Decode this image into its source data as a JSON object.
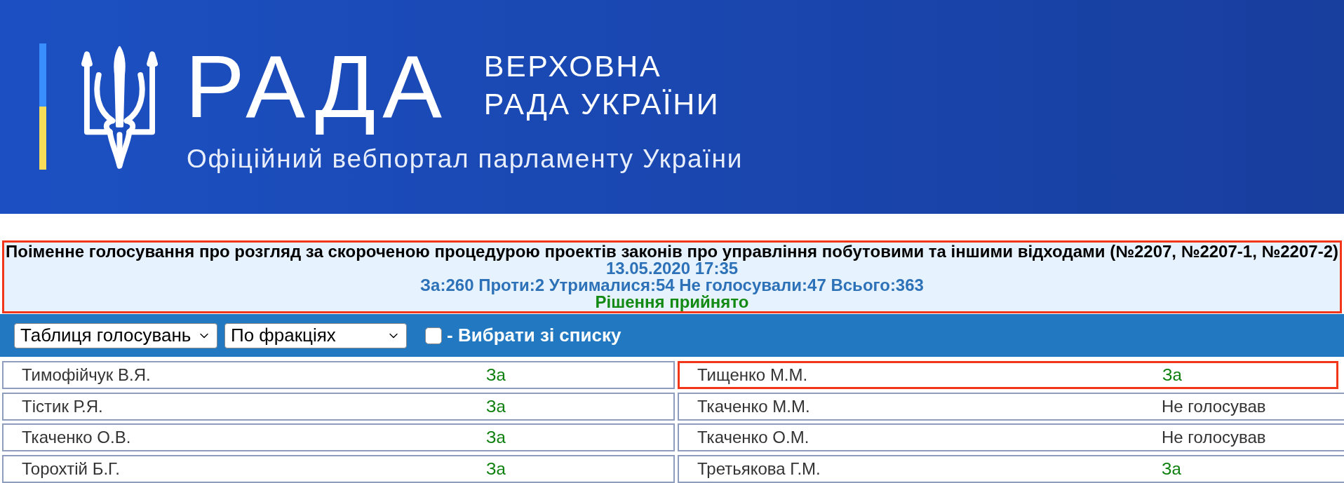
{
  "header": {
    "logo_text": "РАДА",
    "title_lines": [
      "ВЕРХОВНА",
      "РАДА УКРАЇНИ"
    ],
    "tagline": "Офіційний вебпортал парламенту України"
  },
  "vote_summary": {
    "highlighted": true,
    "title": "Поіменне голосування про розгляд за скороченою процедурою проектів законів про управління побутовими та іншими відходами (№2207, №2207-1, №2207-2)",
    "datetime": "13.05.2020 17:35",
    "counts": "За:260 Проти:2 Утрималися:54 Не голосували:47 Всього:363",
    "decision": "Рішення прийнято"
  },
  "toolbar": {
    "dropdowns": [
      {
        "value": "Таблиця голосувань"
      },
      {
        "value": "По фракціях"
      }
    ],
    "checkbox": {
      "checked": false,
      "label": "- Вибрати зі списку"
    }
  },
  "columns": [
    {
      "rows": [
        {
          "name": "Тимофійчук В.Я.",
          "vote": "За",
          "kind": "for",
          "highlighted": false
        },
        {
          "name": "Тістик Р.Я.",
          "vote": "За",
          "kind": "for",
          "highlighted": false
        },
        {
          "name": "Ткаченко О.В.",
          "vote": "За",
          "kind": "for",
          "highlighted": false
        },
        {
          "name": "Торохтій Б.Г.",
          "vote": "За",
          "kind": "for",
          "highlighted": false
        }
      ]
    },
    {
      "rows": [
        {
          "name": "Тищенко М.М.",
          "vote": "За",
          "kind": "for",
          "highlighted": true
        },
        {
          "name": "Ткаченко М.М.",
          "vote": "Не голосував",
          "kind": "not_voted",
          "highlighted": false
        },
        {
          "name": "Ткаченко О.М.",
          "vote": "Не голосував",
          "kind": "not_voted",
          "highlighted": false
        },
        {
          "name": "Третьякова Г.М.",
          "vote": "За",
          "kind": "for",
          "highlighted": false
        }
      ]
    }
  ]
}
